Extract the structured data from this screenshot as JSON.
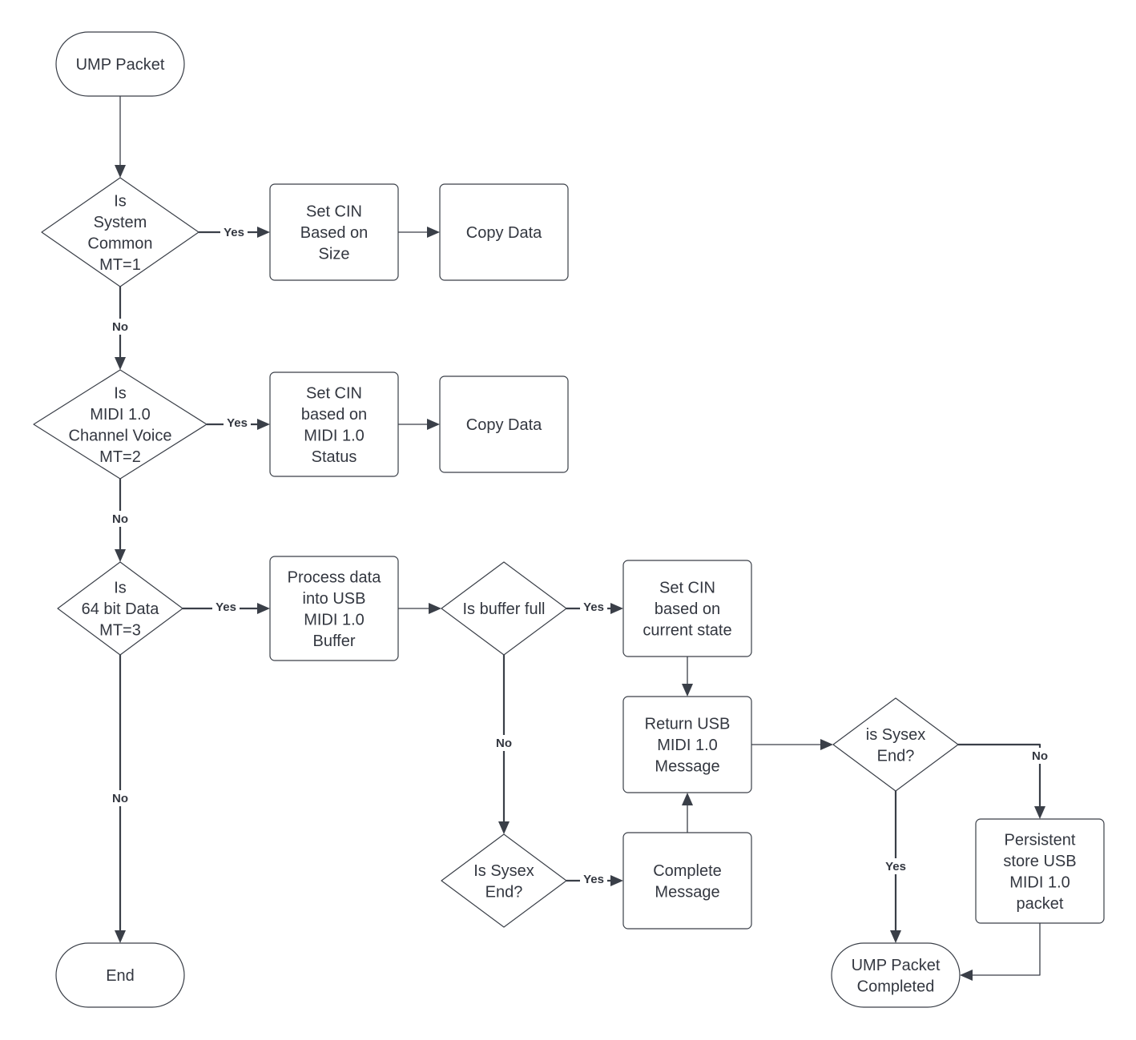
{
  "diagram": {
    "type": "flowchart",
    "nodes": [
      {
        "id": "ump_packet",
        "kind": "terminal",
        "lines": [
          "UMP Packet"
        ]
      },
      {
        "id": "is_system_common",
        "kind": "decision",
        "lines": [
          "Is",
          "System",
          "Common",
          "MT=1"
        ]
      },
      {
        "id": "set_cin_size",
        "kind": "process",
        "lines": [
          "Set CIN",
          "Based on",
          "Size"
        ]
      },
      {
        "id": "copy_data_1",
        "kind": "process",
        "lines": [
          "Copy Data"
        ]
      },
      {
        "id": "is_midi1_cv",
        "kind": "decision",
        "lines": [
          "Is",
          "MIDI 1.0",
          "Channel Voice",
          "MT=2"
        ]
      },
      {
        "id": "set_cin_status",
        "kind": "process",
        "lines": [
          "Set CIN",
          "based on",
          "MIDI 1.0",
          "Status"
        ]
      },
      {
        "id": "copy_data_2",
        "kind": "process",
        "lines": [
          "Copy Data"
        ]
      },
      {
        "id": "is_64bit",
        "kind": "decision",
        "lines": [
          "Is",
          "64 bit Data",
          "MT=3"
        ]
      },
      {
        "id": "process_data",
        "kind": "process",
        "lines": [
          "Process data",
          "into USB",
          "MIDI 1.0",
          "Buffer"
        ]
      },
      {
        "id": "is_buffer_full",
        "kind": "decision",
        "lines": [
          "Is buffer full"
        ]
      },
      {
        "id": "set_cin_state",
        "kind": "process",
        "lines": [
          "Set CIN",
          "based on",
          "current state"
        ]
      },
      {
        "id": "return_usb",
        "kind": "process",
        "lines": [
          "Return USB",
          "MIDI 1.0",
          "Message"
        ]
      },
      {
        "id": "is_sysex_end_1",
        "kind": "decision",
        "lines": [
          "Is Sysex",
          "End?"
        ]
      },
      {
        "id": "complete_message",
        "kind": "process",
        "lines": [
          "Complete",
          "Message"
        ]
      },
      {
        "id": "is_sysex_end_2",
        "kind": "decision",
        "lines": [
          "is Sysex",
          "End?"
        ]
      },
      {
        "id": "persistent_store",
        "kind": "process",
        "lines": [
          "Persistent",
          "store USB",
          "MIDI 1.0",
          "packet"
        ]
      },
      {
        "id": "ump_completed",
        "kind": "terminal",
        "lines": [
          "UMP Packet",
          "Completed"
        ]
      },
      {
        "id": "end",
        "kind": "terminal",
        "lines": [
          "End"
        ]
      }
    ],
    "edges": [
      {
        "from": "ump_packet",
        "to": "is_system_common",
        "label": ""
      },
      {
        "from": "is_system_common",
        "to": "set_cin_size",
        "label": "Yes"
      },
      {
        "from": "set_cin_size",
        "to": "copy_data_1",
        "label": ""
      },
      {
        "from": "is_system_common",
        "to": "is_midi1_cv",
        "label": "No"
      },
      {
        "from": "is_midi1_cv",
        "to": "set_cin_status",
        "label": "Yes"
      },
      {
        "from": "set_cin_status",
        "to": "copy_data_2",
        "label": ""
      },
      {
        "from": "is_midi1_cv",
        "to": "is_64bit",
        "label": "No"
      },
      {
        "from": "is_64bit",
        "to": "process_data",
        "label": "Yes"
      },
      {
        "from": "is_64bit",
        "to": "end",
        "label": "No"
      },
      {
        "from": "process_data",
        "to": "is_buffer_full",
        "label": ""
      },
      {
        "from": "is_buffer_full",
        "to": "set_cin_state",
        "label": "Yes"
      },
      {
        "from": "is_buffer_full",
        "to": "is_sysex_end_1",
        "label": "No"
      },
      {
        "from": "set_cin_state",
        "to": "return_usb",
        "label": ""
      },
      {
        "from": "is_sysex_end_1",
        "to": "complete_message",
        "label": "Yes"
      },
      {
        "from": "complete_message",
        "to": "return_usb",
        "label": ""
      },
      {
        "from": "return_usb",
        "to": "is_sysex_end_2",
        "label": ""
      },
      {
        "from": "is_sysex_end_2",
        "to": "persistent_store",
        "label": "No"
      },
      {
        "from": "is_sysex_end_2",
        "to": "ump_completed",
        "label": "Yes"
      },
      {
        "from": "persistent_store",
        "to": "ump_completed",
        "label": ""
      }
    ],
    "colors": {
      "stroke": "#3a3f48",
      "text": "#333740",
      "background": "#ffffff"
    }
  }
}
